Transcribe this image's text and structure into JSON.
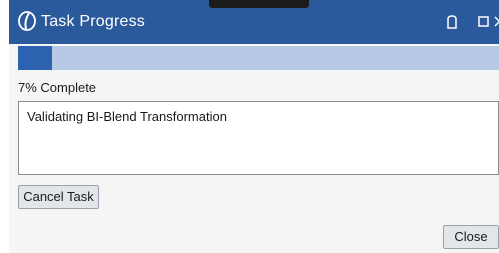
{
  "window": {
    "title": "Task Progress",
    "app_icon": "brand-logo-icon",
    "controls": {
      "restore_icon": "restore-icon",
      "maximize_icon": "maximize-icon",
      "close_icon": "close-icon"
    }
  },
  "progress": {
    "percent": 7,
    "label": "7% Complete"
  },
  "status": {
    "message": "Validating BI-Blend Transformation"
  },
  "buttons": {
    "cancel_label": "Cancel Task",
    "close_label": "Close"
  },
  "colors": {
    "titlebar": "#2a5a9c",
    "progress_fill": "#2d62b0",
    "progress_track": "#b7c9e4"
  }
}
